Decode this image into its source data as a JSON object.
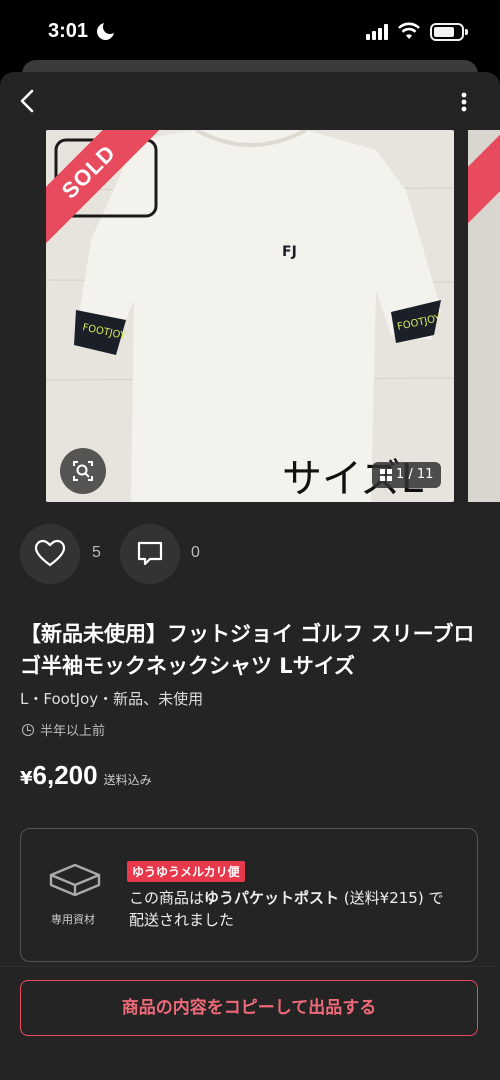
{
  "status_bar": {
    "time": "3:01"
  },
  "product": {
    "sold_label": "SOLD",
    "image_overlay_text": "サイズL",
    "photo_counter": "1 / 11",
    "shirt_logo": "FJ",
    "sleeve_text": "FOOTJOY",
    "likes": "5",
    "comments": "0",
    "title": "【新品未使用】フットジョイ ゴルフ スリーブロゴ半袖モックネックシャツ Lサイズ",
    "meta": "L・FootJoy・新品、未使用",
    "posted": "半年以上前",
    "price_currency": "¥",
    "price": "6,200",
    "shipping_note": "送料込み"
  },
  "shipping": {
    "box_label": "専用資材",
    "badge": "ゆうゆうメルカリ便",
    "text_prefix": "この商品は",
    "text_method": "ゆうパケットポスト",
    "text_suffix": " (送料¥215) で配送されました"
  },
  "footer": {
    "copy_button": "商品の内容をコピーして出品する"
  },
  "colors": {
    "accent": "#e84b5d",
    "background": "#242424"
  },
  "icons": [
    "back-arrow-icon",
    "more-vertical-icon",
    "lens-search-icon",
    "grid-icon",
    "heart-icon",
    "comment-icon",
    "clock-icon",
    "package-box-icon"
  ]
}
